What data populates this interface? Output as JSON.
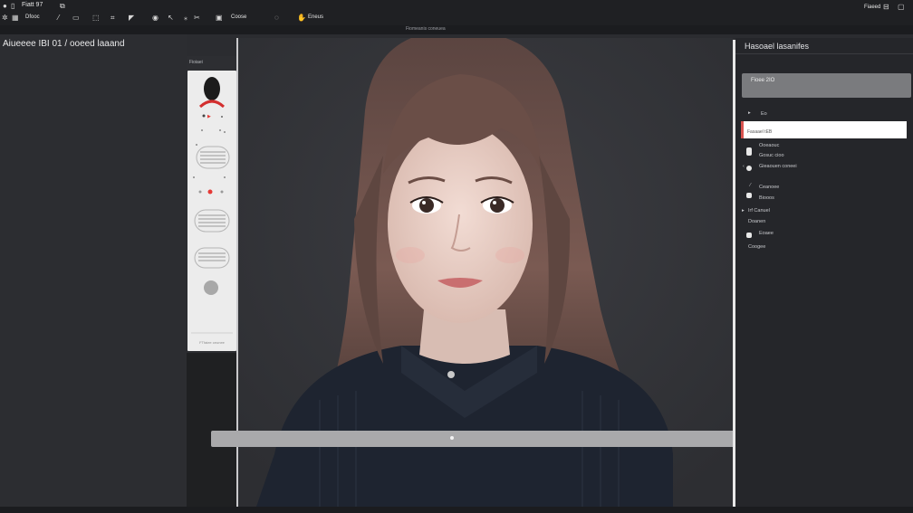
{
  "menubar": {
    "items": [
      "Fiatt 97"
    ],
    "right_label": "Fiaeed",
    "toolbar_labels": [
      "Dfooc",
      "Coose",
      "Eneus"
    ]
  },
  "tabstrip": {
    "label": "Fiomeanis coneuea"
  },
  "document": {
    "title": "Aiueeee IBI 01 / ooeed laaand"
  },
  "tools": {
    "header_label": "Fioiaei",
    "footer_label": "FTfaiee ceunee"
  },
  "right_panel": {
    "title": "Hasoael lasanifes",
    "box_label": "Fioee 2IO",
    "input_value": "Fasaael tEB",
    "rows": [
      "Eo",
      "Ooeaouc",
      "Gosuc cioo",
      "Gieaouen coneei",
      "Ceanoee",
      "Biooos",
      "Irf Canuel",
      "Doanen",
      "Eoaee",
      "Coogee"
    ]
  },
  "colors": {
    "accent": "#d9534f",
    "menubar_bg": "#1f2023",
    "canvas_bg": "#333438",
    "panel_bg": "#25262a",
    "tool_panel_bg": "#ececec",
    "scrubber": "#a9a9ab"
  },
  "icons": [
    "file-icon",
    "layers-icon",
    "brush-icon",
    "move-icon",
    "eye-icon",
    "gear-icon",
    "scissors-icon",
    "zoom-icon",
    "window-minimize-icon",
    "window-restore-icon",
    "window-close-icon"
  ]
}
